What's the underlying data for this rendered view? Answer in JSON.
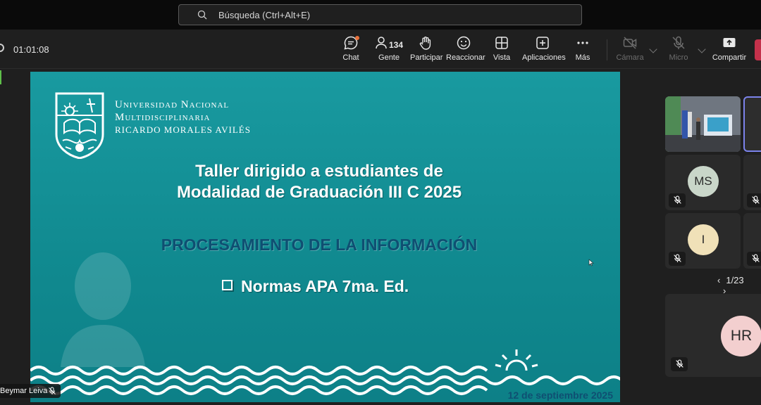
{
  "search": {
    "placeholder": "Búsqueda (Ctrl+Alt+E)"
  },
  "meeting": {
    "elapsed": "01:01:08"
  },
  "toolbar": {
    "chat": "Chat",
    "people": "Gente",
    "people_count": "134",
    "raise_hand": "Participar",
    "react": "Reaccionar",
    "view": "Vista",
    "apps": "Aplicaciones",
    "more": "Más",
    "camera": "Cámara",
    "mic": "Micro",
    "share": "Compartir"
  },
  "slide": {
    "university_line1": "Universidad Nacional",
    "university_line2": "Multidisciplinaria",
    "university_line3": "RICARDO MORALES AVILÉS",
    "title_line1": "Taller dirigido a estudiantes de",
    "title_line2": "Modalidad de Graduación III C 2025",
    "subtitle": "PROCESAMIENTO DE LA INFORMACIÓN",
    "bullet": "Normas APA 7ma. Ed.",
    "date": "12 de septiembre 2025"
  },
  "presenter": {
    "name": "Beymar Leiva"
  },
  "gallery": {
    "participants": [
      {
        "initials": "MS",
        "color": "#c9d6c9"
      },
      {
        "initials": "I",
        "color": "#f0e1b8"
      },
      {
        "initials": "HR",
        "color": "#f3cfcf"
      }
    ],
    "page": "1/23"
  },
  "colors": {
    "accent": "#7b83eb",
    "slide_bg": "#129097",
    "leave": "#c4314b",
    "notification": "#e8703a"
  }
}
